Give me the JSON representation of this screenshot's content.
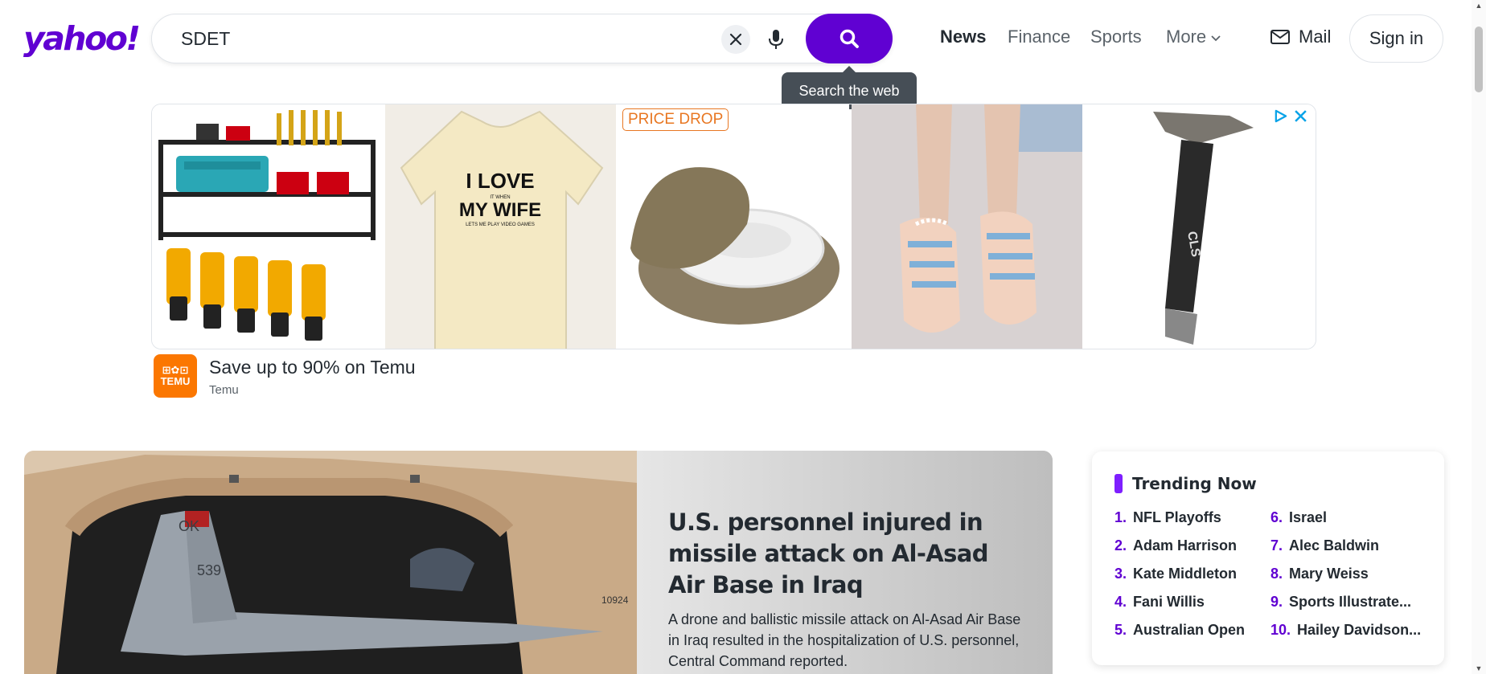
{
  "header": {
    "logo_text": "yahoo!",
    "search_value": "SDET",
    "tooltip": "Search the web",
    "nav": {
      "news": "News",
      "finance": "Finance",
      "sports": "Sports",
      "more": "More"
    },
    "mail": "Mail",
    "sign_in": "Sign in"
  },
  "ad": {
    "tile_badge": "PRICE DROP",
    "tshirt_line1": "I LOVE",
    "tshirt_small": "IT WHEN",
    "tshirt_line2": "MY WIFE",
    "tshirt_line3": "LETS ME PLAY VIDEO GAMES",
    "advertiser_logo": "TEMU",
    "title": "Save up to 90% on Temu",
    "advertiser": "Temu"
  },
  "hero": {
    "title": "U.S. personnel injured in missile attack on Al-Asad Air Base in Iraq",
    "summary": "A drone and ballistic missile attack on Al-Asad Air Base in Iraq resulted in the hospitalization of U.S. personnel, Central Command reported.",
    "tail_code": "OK",
    "tail_number": "539",
    "hangar_number": "10924"
  },
  "trending": {
    "title": "Trending Now",
    "items": [
      {
        "num": "1.",
        "label": "NFL Playoffs"
      },
      {
        "num": "6.",
        "label": "Israel"
      },
      {
        "num": "2.",
        "label": "Adam Harrison"
      },
      {
        "num": "7.",
        "label": "Alec Baldwin"
      },
      {
        "num": "3.",
        "label": "Kate Middleton"
      },
      {
        "num": "8.",
        "label": "Mary Weiss"
      },
      {
        "num": "4.",
        "label": "Fani Willis"
      },
      {
        "num": "9.",
        "label": "Sports Illustrate..."
      },
      {
        "num": "5.",
        "label": "Australian Open"
      },
      {
        "num": "10.",
        "label": "Hailey Davidson..."
      }
    ]
  },
  "colors": {
    "brand": "#6001d2",
    "temu": "#fb7701",
    "trending_accent": "#7e1fff"
  }
}
